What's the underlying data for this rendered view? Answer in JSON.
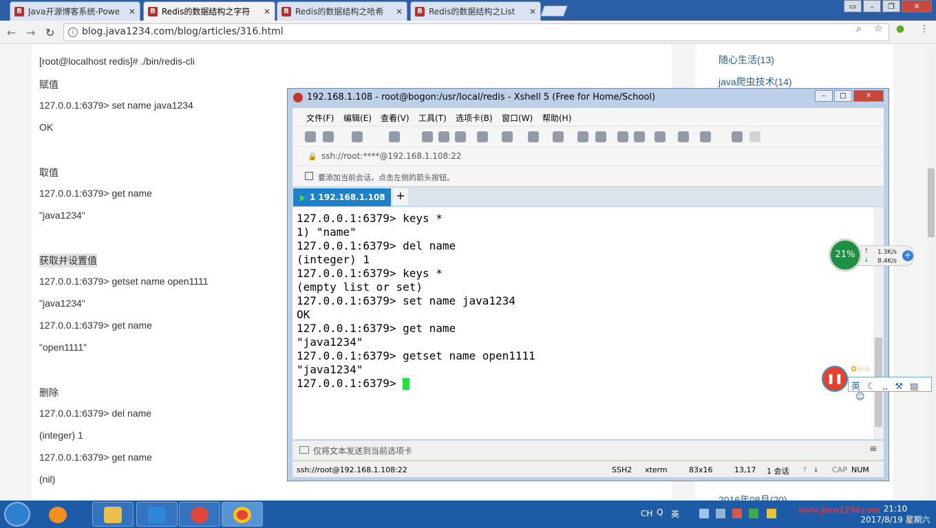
{
  "browser": {
    "tabs": [
      {
        "label": "Java开源博客系统-Powe",
        "active": false
      },
      {
        "label": "Redis的数据结构之字符",
        "active": true
      },
      {
        "label": "Redis的数据结构之哈希",
        "active": false
      },
      {
        "label": "Redis的数据结构之List",
        "active": false
      }
    ],
    "url": "blog.java1234.com/blog/articles/316.html"
  },
  "article": {
    "lines": [
      {
        "text": "[root@localhost redis]# ./bin/redis-cli",
        "highlight": false
      },
      {
        "text": "赋值",
        "highlight": false
      },
      {
        "text": "127.0.0.1:6379> set name java1234",
        "highlight": false
      },
      {
        "text": "OK",
        "highlight": false
      },
      {
        "text": "",
        "highlight": false
      },
      {
        "text": "取值",
        "highlight": false
      },
      {
        "text": "127.0.0.1:6379> get name",
        "highlight": false
      },
      {
        "text": "\"java1234\"",
        "highlight": false
      },
      {
        "text": "",
        "highlight": false
      },
      {
        "text": "获取并设置值",
        "highlight": true
      },
      {
        "text": "127.0.0.1:6379> getset name open1111",
        "highlight": false
      },
      {
        "text": "\"java1234\"",
        "highlight": false
      },
      {
        "text": "127.0.0.1:6379> get name",
        "highlight": false
      },
      {
        "text": "\"open1111\"",
        "highlight": false
      },
      {
        "text": "",
        "highlight": false
      },
      {
        "text": "删除",
        "highlight": false
      },
      {
        "text": "127.0.0.1:6379> del name",
        "highlight": false
      },
      {
        "text": "(integer) 1",
        "highlight": false
      },
      {
        "text": "127.0.0.1:6379> get name",
        "highlight": false
      },
      {
        "text": "(nil)",
        "highlight": false
      }
    ]
  },
  "sidebar": {
    "links": [
      "随心生活(13)",
      "java爬虫技术(14)",
      "2016年08月(20)"
    ]
  },
  "xshell": {
    "title": "192.168.1.108 - root@bogon:/usr/local/redis - Xshell 5 (Free for Home/School)",
    "menu": [
      "文件(F)",
      "编辑(E)",
      "查看(V)",
      "工具(T)",
      "选项卡(B)",
      "窗口(W)",
      "帮助(H)"
    ],
    "address": "ssh://root:****@192.168.1.108:22",
    "hint": "要添加当前会话，点击左侧的箭头按钮。",
    "tab_label": "1 192.168.1.108",
    "terminal_lines": [
      "127.0.0.1:6379> keys *",
      "1) \"name\"",
      "127.0.0.1:6379> del name",
      "(integer) 1",
      "127.0.0.1:6379> keys *",
      "(empty list or set)",
      "127.0.0.1:6379> set name java1234",
      "OK",
      "127.0.0.1:6379> get name",
      "\"java1234\"",
      "127.0.0.1:6379> getset name open1111",
      "\"java1234\"",
      "127.0.0.1:6379> "
    ],
    "send_placeholder": "仅将文本发送到当前选项卡",
    "status": {
      "connection": "ssh://root@192.168.1.108:22",
      "protocol": "SSH2",
      "term": "xterm",
      "size": "83x16",
      "position": "13,17",
      "sessions": "1 会话",
      "cap": "CAP",
      "num": "NUM"
    }
  },
  "widgets": {
    "cpu": "21%",
    "upload": "1.3K/s",
    "download": "8.4K/s",
    "ime_mode": "英"
  },
  "taskbar": {
    "tray_lang": "CH",
    "tray_ime": "英",
    "watermark": "www.java1234.com",
    "time": "21:10",
    "date": "2017/8/19 星期六"
  }
}
